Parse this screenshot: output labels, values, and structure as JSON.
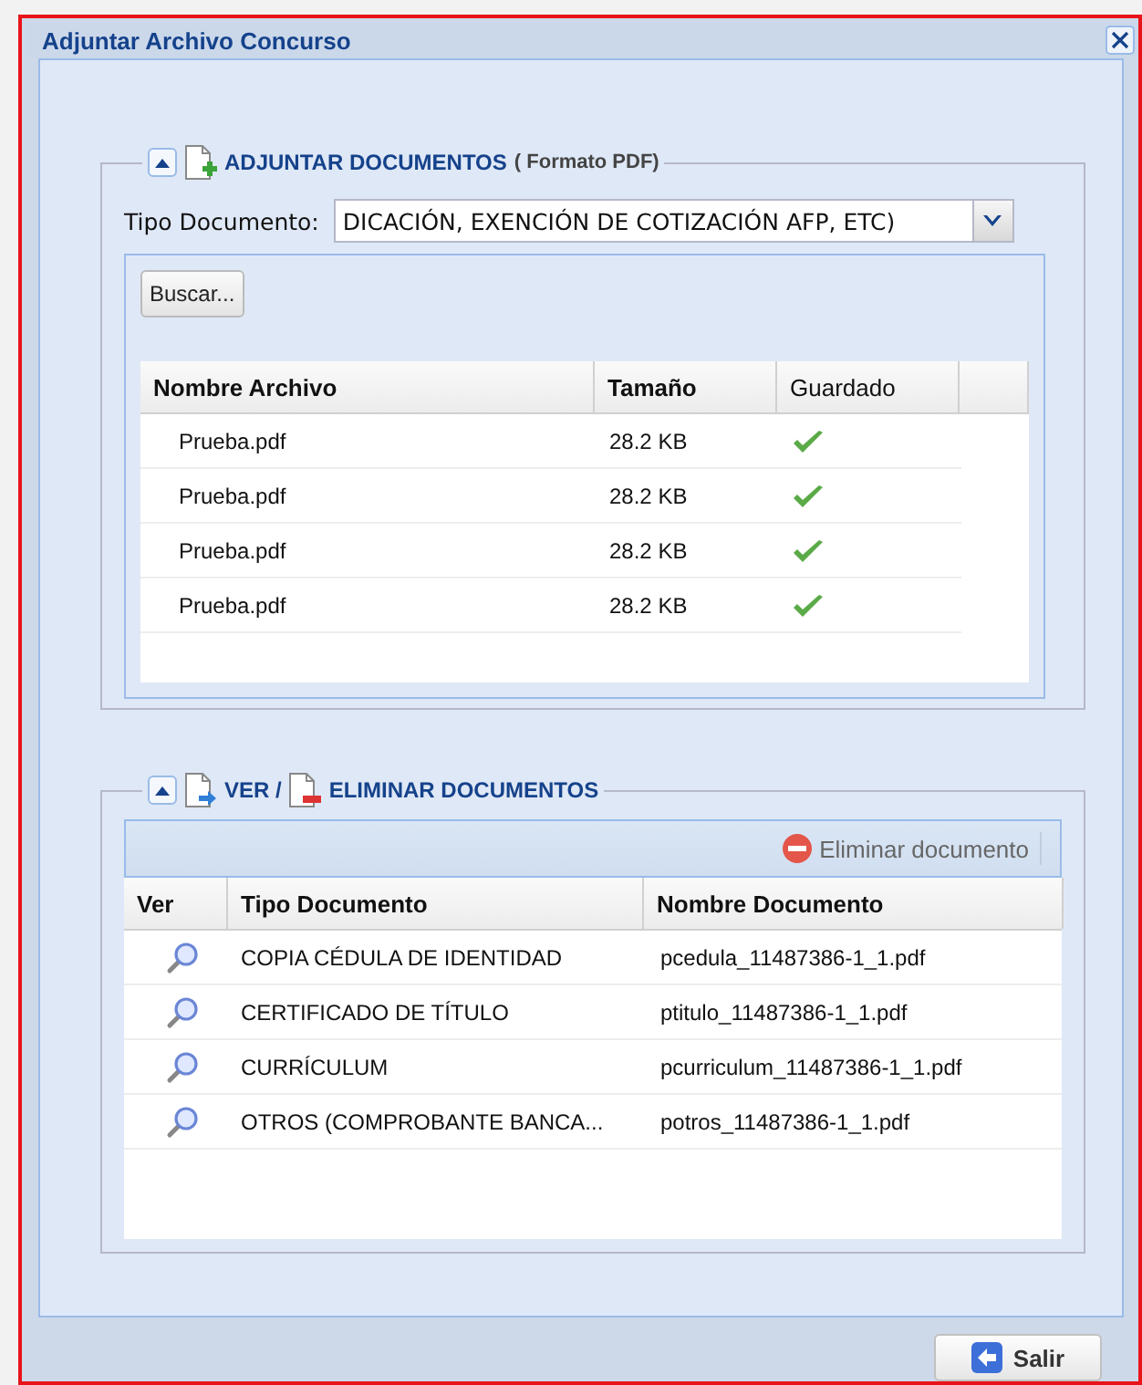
{
  "window": {
    "title": "Adjuntar Archivo Concurso"
  },
  "attach": {
    "expanded": true,
    "legend": "ADJUNTAR DOCUMENTOS",
    "note": "( Formato PDF)",
    "type_label": "Tipo Documento:",
    "type_value": "DICACIÓN, EXENCIÓN DE COTIZACIÓN AFP, ETC)",
    "browse": "Buscar...",
    "columns": [
      "Nombre Archivo",
      "Tamaño",
      "Guardado"
    ],
    "rows": [
      {
        "name": "Prueba.pdf",
        "size": "28.2 KB",
        "saved": true
      },
      {
        "name": "Prueba.pdf",
        "size": "28.2 KB",
        "saved": true
      },
      {
        "name": "Prueba.pdf",
        "size": "28.2 KB",
        "saved": true
      },
      {
        "name": "Prueba.pdf",
        "size": "28.2 KB",
        "saved": true
      }
    ]
  },
  "view": {
    "expanded": true,
    "legend_view": "VER /",
    "legend_delete": "ELIMINAR DOCUMENTOS",
    "delete_button": "Eliminar documento",
    "columns": [
      "Ver",
      "Tipo Documento",
      "Nombre Documento"
    ],
    "rows": [
      {
        "type": "COPIA CÉDULA DE IDENTIDAD",
        "file": "pcedula_11487386-1_1.pdf"
      },
      {
        "type": "CERTIFICADO DE TÍTULO",
        "file": "ptitulo_11487386-1_1.pdf"
      },
      {
        "type": "CURRÍCULUM",
        "file": "pcurriculum_11487386-1_1.pdf"
      },
      {
        "type": "OTROS (COMPROBANTE BANCA...",
        "file": "potros_11487386-1_1.pdf"
      }
    ]
  },
  "footer": {
    "exit": "Salir"
  }
}
